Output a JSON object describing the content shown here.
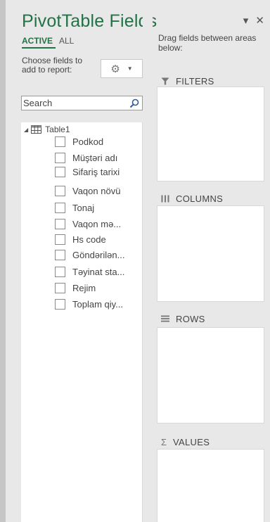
{
  "panel": {
    "title": "PivotTable Fields",
    "tabs": [
      {
        "label": "ACTIVE",
        "active": true
      },
      {
        "label": "ALL",
        "active": false
      }
    ],
    "choose_text": "Choose fields to add to report:",
    "tools_icon": "gear-icon",
    "header_icons": [
      "chevron-down-icon",
      "close-icon"
    ],
    "search": {
      "placeholder": "Search",
      "value": ""
    },
    "table_name": "Table1",
    "fields": [
      {
        "label": "Podkod",
        "checked": false
      },
      {
        "label": "Müştəri adı",
        "checked": false
      },
      {
        "label": "Sifariş tarixi",
        "checked": false
      },
      {
        "label": "Vaqon növü",
        "checked": false
      },
      {
        "label": "Tonaj",
        "checked": false
      },
      {
        "label": "Vaqon mə...",
        "checked": false
      },
      {
        "label": "Hs code",
        "checked": false
      },
      {
        "label": "Göndərilən...",
        "checked": false
      },
      {
        "label": "Təyinat sta...",
        "checked": false
      },
      {
        "label": "Rejim",
        "checked": false
      },
      {
        "label": "Toplam qiy...",
        "checked": false
      }
    ]
  },
  "areas": {
    "hint": "Drag fields between areas below:",
    "filters_label": "FILTERS",
    "columns_label": "COLUMNS",
    "rows_label": "ROWS",
    "values_label": "VALUES",
    "values_symbol": "Σ"
  },
  "colors": {
    "accent": "#217346",
    "panel_bg": "#e8e8e8",
    "area_bg": "#ffffff"
  }
}
